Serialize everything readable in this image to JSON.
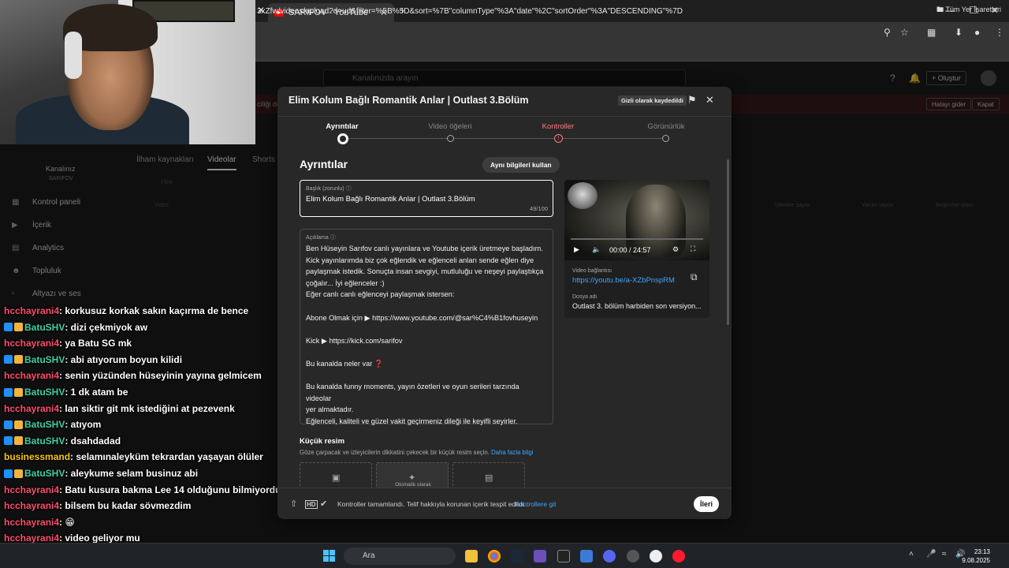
{
  "browser": {
    "tab_title": "SARIFOV - YouTube",
    "new_tab": "+",
    "url": "3xZfw/videos/upload?d=ud&filter=%5B%5D&sort=%7B\"columnType\"%3A\"date\"%2C\"sortOrder\"%3A\"DESCENDING\"%7D",
    "bookmarks_label": "Tüm Yer İşaretleri",
    "win_minimize": "—",
    "win_maximize": "☐",
    "win_close": "✕"
  },
  "studio": {
    "search_placeholder": "Kanalınızda arayın",
    "create_label": "Oluştur",
    "banner_text": "ciliği devre",
    "banner_btn1": "Hatayı gider",
    "banner_btn2": "Kapat",
    "channel_title": "Kanalınız",
    "channel_name": "SARIFOV",
    "sidebar": [
      {
        "label": "Kontrol paneli",
        "icon": "dashboard-icon"
      },
      {
        "label": "İçerik",
        "icon": "content-icon"
      },
      {
        "label": "Analytics",
        "icon": "analytics-icon"
      },
      {
        "label": "Topluluk",
        "icon": "community-icon"
      },
      {
        "label": "Altyazı ve ses",
        "icon": "subtitles-icon"
      }
    ],
    "content_tabs": [
      "İlham kaynakları",
      "Videolar",
      "Shorts v"
    ],
    "filter_label": "Filtre",
    "column_video": "Video",
    "columns_right": [
      "İzlenme sayısı",
      "Yorum sayısı",
      "Beğenme orası"
    ]
  },
  "chat": [
    {
      "user": "hcchayrani4",
      "msg": " : korkusuz korkak sakın kaçırma de bence",
      "color": "#ff4d6d",
      "badges": false
    },
    {
      "user": "BatuSHV",
      "msg": " : dizi çekmiyok aw",
      "color": "#3fd1a6",
      "badges": true
    },
    {
      "user": "hcchayrani4",
      "msg": " : ya Batu SG mk",
      "color": "#ff4d6d",
      "badges": false
    },
    {
      "user": "BatuSHV",
      "msg": " : abi atıyorum boyun kilidi",
      "color": "#3fd1a6",
      "badges": true
    },
    {
      "user": "hcchayrani4",
      "msg": " : senin yüzünden hüseyinin yayına gelmicem",
      "color": "#ff4d6d",
      "badges": false
    },
    {
      "user": "BatuSHV",
      "msg": " : 1 dk atam be",
      "color": "#3fd1a6",
      "badges": true
    },
    {
      "user": "hcchayrani4",
      "msg": " : lan siktir git mk istediğini at pezevenk",
      "color": "#ff4d6d",
      "badges": false
    },
    {
      "user": "BatuSHV",
      "msg": " : atıyom",
      "color": "#3fd1a6",
      "badges": true
    },
    {
      "user": "BatuSHV",
      "msg": " : dsahdadad",
      "color": "#3fd1a6",
      "badges": true
    },
    {
      "user": "businessmand",
      "msg": " : selamınaleyküm tekrardan yaşayan ölüler",
      "color": "#f5c518",
      "badges": false
    },
    {
      "user": "BatuSHV",
      "msg": " : aleykume selam businuz abi",
      "color": "#3fd1a6",
      "badges": true
    },
    {
      "user": "hcchayrani4",
      "msg": " : Batu kusura bakma Lee 14 olduğunu bilmiyordum",
      "color": "#ff4d6d",
      "badges": false
    },
    {
      "user": "hcchayrani4",
      "msg": " : bilsem bu kadar sövmezdim",
      "color": "#ff4d6d",
      "badges": false
    },
    {
      "user": "hcchayrani4",
      "msg": " : 😁",
      "color": "#ff4d6d",
      "badges": false
    },
    {
      "user": "hcchayrani4",
      "msg": " : video geliyor mu",
      "color": "#ff4d6d",
      "badges": false
    }
  ],
  "dialog": {
    "title": "Elim Kolum Bağlı Romantik Anlar | Outlast 3.Bölüm",
    "draft_badge": "Gizli olarak kaydedildi",
    "steps": [
      "Ayrıntılar",
      "Video öğeleri",
      "Kontroller",
      "Görünürlük"
    ],
    "steps_status": [
      "active",
      "pending",
      "warning",
      "pending"
    ],
    "section_title": "Ayrıntılar",
    "reuse_button": "Aynı bilgileri kullan",
    "title_field": {
      "label": "Başlık (zorunlu)",
      "value": "Elim Kolum Bağlı Romantik Anlar | Outlast 3.Bölüm",
      "counter": "49/100"
    },
    "description_field": {
      "label": "Açıklama",
      "lines": [
        "Ben Hüseyin Sarıfov canlı yayınlara ve Youtube içerik üretmeye başladım.",
        "Kick yayınlarımda biz çok eğlendik ve eğlenceli anları sende eğlen diye",
        "paylaşmak istedik. Sonuçta insan sevgiyi, mutluluğu ve neşeyi paylaştıkça",
        "çoğalır... İyi eğlenceler :)",
        "Eğer canlı canlı eğlenceyi paylaşmak istersen:",
        "",
        "Abone Olmak için ▶ https://www.youtube.com/@sar%C4%B1fovhuseyin",
        "",
        "Kick ▶ https://kick.com/sarifov",
        "",
        "Bu kanalda neler var ❓",
        "",
        "Bu kanalda funny moments, yayın özetleri ve oyun serileri tarzında videolar",
        "yer almaktadır.",
        "Eğlenceli, kaliteli ve güzel vakit geçirmeniz dileği ile keyifli seyirler."
      ]
    },
    "preview": {
      "time": "00:00 / 24:57",
      "link_label": "Video bağlantısı",
      "link": "https://youtu.be/a-XZbPnspRM",
      "file_label": "Dosya adı",
      "file_name": "Outlast 3. bölüm harbiden son versiyon..."
    },
    "thumbnail": {
      "title": "Küçük resim",
      "subtitle": "Göze çarpacak ve izleyicilerin dikkatini çekecek bir küçük resim seçin.",
      "learn_more": "Daha fazla bilgi",
      "auto_label": "Otomatik olarak"
    },
    "footer": {
      "status": "Kontroller tamamlandı. Telif hakkıyla korunan içerik tespit edildi.",
      "link": "Kontrollere git",
      "next": "İleri",
      "hd": "HD"
    }
  },
  "taskbar": {
    "search": "Ara",
    "time": "23:13",
    "date": "9.08.2025"
  },
  "colors": {
    "accent_link": "#3ea6ff",
    "warning": "#ff7a7a",
    "dialog_bg": "#282828"
  }
}
